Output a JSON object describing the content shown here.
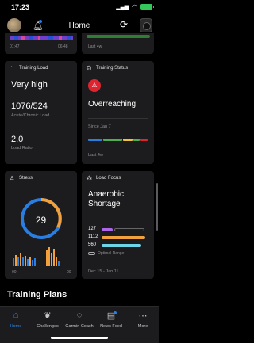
{
  "status_bar": {
    "time": "17:23"
  },
  "header": {
    "title": "Home"
  },
  "top_cards": {
    "left": {
      "time_start": "01:47",
      "time_end": "06:48"
    },
    "right": {
      "period": "Last 4w"
    }
  },
  "training_load": {
    "title": "Training Load",
    "level": "Very high",
    "ratio_value": "1076/524",
    "ratio_label": "Acute/Chronic Load",
    "load_ratio_value": "2.0",
    "load_ratio_label": "Load Ratio"
  },
  "training_status": {
    "title": "Training Status",
    "status": "Overreaching",
    "since": "Since Jan 7",
    "period": "Last 4w",
    "colors": {
      "badge": "#e0242f"
    }
  },
  "stress": {
    "title": "Stress",
    "value": "29",
    "axis_left": "00",
    "axis_right": "00",
    "level_fraction": 0.29,
    "colors": {
      "rest": "#2a7de1",
      "stress": "#f2a03d"
    }
  },
  "load_focus": {
    "title": "Load Focus",
    "focus_line1": "Anaerobic",
    "focus_line2": "Shortage",
    "rows": [
      {
        "value": "127",
        "color": "#b066e8",
        "fill": 0.12
      },
      {
        "value": "1112",
        "color": "#f2a03d",
        "fill": 1.0
      },
      {
        "value": "560",
        "color": "#6cd6e8",
        "fill": 0.9
      }
    ],
    "legend": "Optimal Range",
    "dates": "Dec 15 - Jan 11"
  },
  "section": {
    "title": "Training Plans"
  },
  "tabbar": {
    "items": [
      {
        "label": "Home",
        "icon": "home-icon"
      },
      {
        "label": "Challenges",
        "icon": "laurel-icon"
      },
      {
        "label": "Garmin Coach",
        "icon": "whistle-icon"
      },
      {
        "label": "News Feed",
        "icon": "newsfeed-icon"
      },
      {
        "label": "More",
        "icon": "more-icon"
      }
    ],
    "active_color": "#2a8bf2"
  }
}
